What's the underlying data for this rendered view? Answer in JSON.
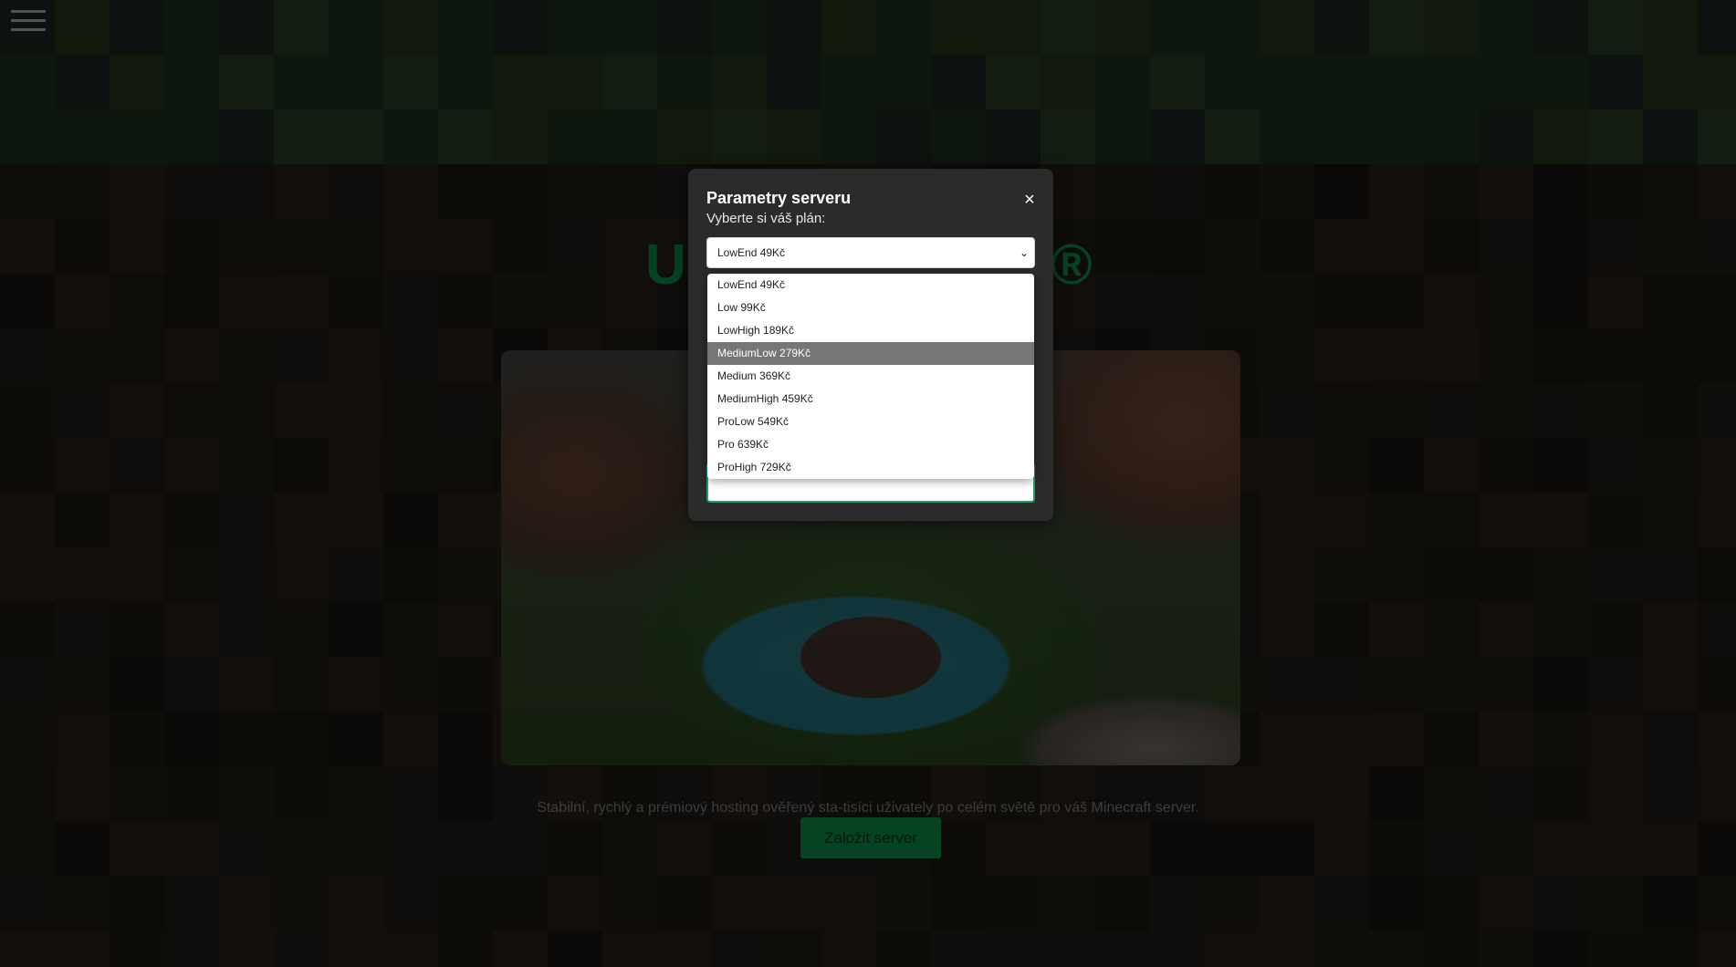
{
  "nav": {
    "menu_icon": "hamburger-menu-icon"
  },
  "hero": {
    "title_left": "U",
    "title_right": "®",
    "tagline": "Stabilní, rychlý a prémiový hosting ověřený sta-tisíci uživately po celém světě pro váš Minecraft server.",
    "cta_label": "Založit server"
  },
  "modal": {
    "title": "Parametry serveru",
    "close_icon": "close-icon",
    "subtitle": "Vyberte si váš plán:",
    "plan_select": {
      "selected": "LowEnd 49Kč",
      "highlighted_index": 3,
      "options": [
        "LowEnd 49Kč",
        "Low 99Kč",
        "LowHigh 189Kč",
        "MediumLow 279Kč",
        "Medium 369Kč",
        "MediumHigh 459Kč",
        "ProLow 549Kč",
        "Pro 639Kč",
        "ProHigh 729Kč"
      ]
    }
  },
  "colors": {
    "accent": "#0b7a3e",
    "focus_border": "#17a564",
    "modal_bg": "#2b2b2b",
    "highlight": "#767676"
  }
}
